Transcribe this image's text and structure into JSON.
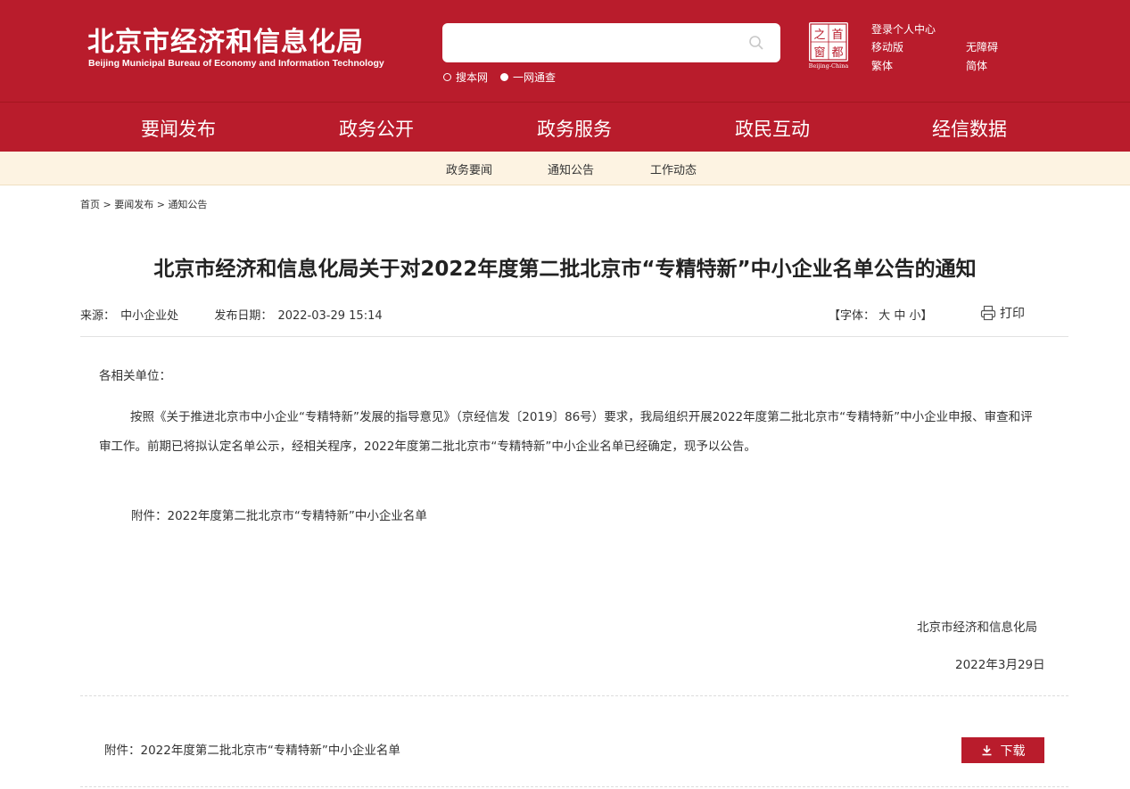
{
  "header": {
    "title_cn": "北京市经济和信息化局",
    "title_en": "Beijing Municipal Bureau of Economy and Information Technology",
    "search": {
      "placeholder": "",
      "option_site": "搜本网",
      "option_all": "一网通查"
    },
    "seal": {
      "chars": [
        "之",
        "首",
        "窗",
        "都"
      ],
      "caption": "Beijing-China"
    },
    "links": {
      "login": "登录个人中心",
      "mobile": "移动版",
      "accessible": "无障碍",
      "traditional": "繁体",
      "simplified": "简体"
    }
  },
  "nav": {
    "items": [
      "要闻发布",
      "政务公开",
      "政务服务",
      "政民互动",
      "经信数据"
    ],
    "sub_items": [
      "政务要闻",
      "通知公告",
      "工作动态"
    ]
  },
  "breadcrumb": {
    "home": "首页",
    "level1": "要闻发布",
    "level2": "通知公告",
    "sep": ">"
  },
  "article": {
    "title": "北京市经济和信息化局关于对2022年度第二批北京市“专精特新”中小企业名单公告的通知",
    "source_label": "来源：",
    "source": "中小企业处",
    "date_label": "发布日期：",
    "date": "2022-03-29 15:14",
    "font_label": "【字体：",
    "font_large": "大",
    "font_medium": "中",
    "font_small": "小】",
    "print_label": "打印",
    "salutation": "各相关单位：",
    "body": "按照《关于推进北京市中小企业“专精特新”发展的指导意见》（京经信发〔2019〕86号）要求，我局组织开展2022年度第二批北京市“专精特新”中小企业申报、审查和评审工作。前期已将拟认定名单公示，经相关程序，2022年度第二批北京市“专精特新”中小企业名单已经确定，现予以公告。",
    "attachment_line": "附件：2022年度第二批北京市“专精特新”中小企业名单",
    "sign_org": "北京市经济和信息化局",
    "sign_date": "2022年3月29日"
  },
  "attachments": {
    "label": "附件：2022年度第二批北京市“专精特新”中小企业名单",
    "download_label": "下载"
  },
  "colors": {
    "brand_red": "#b91c2c",
    "subnav_bg": "#fdf3e2",
    "active_underline": "#f7d49a"
  }
}
